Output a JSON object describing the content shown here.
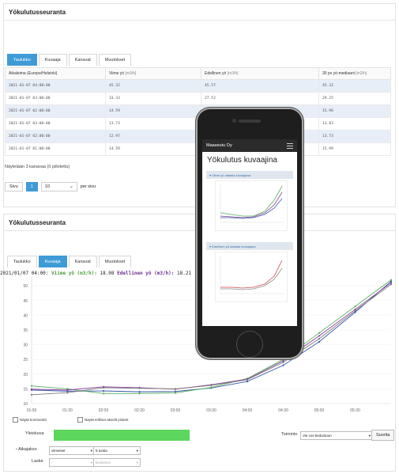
{
  "top_panel": {
    "title": "Yökulutusseuranta",
    "tabs": [
      "Taulukko",
      "Kuvaaja",
      "Kanavat",
      "Muutokset"
    ],
    "active_tab": 0,
    "table": {
      "headers": [
        {
          "label": "Aikaleima (Europe/Helsinki)",
          "unit": ""
        },
        {
          "label": "Viime yö",
          "unit": "[m3/h]"
        },
        {
          "label": "Edellinen yö",
          "unit": "[m3/h]"
        },
        {
          "label": "30 pv yö-mediaani",
          "unit": "[m3/h]"
        }
      ],
      "rows": [
        [
          "2021-01-07 04:00:00",
          "45.32",
          "45.57",
          "45.32"
        ],
        [
          "2021-01-07 03:00:00",
          "33.33",
          "27.52",
          "29.25"
        ],
        [
          "2021-01-07 02:00:00",
          "14.59",
          "",
          "15.96"
        ],
        [
          "2021-01-07 03:00:00",
          "13.73",
          "",
          "13.83"
        ],
        [
          "2021-01-07 02:00:00",
          "12.97",
          "",
          "13.73"
        ],
        [
          "2021-01-07 01:00:00",
          "14.59",
          "",
          "15.99"
        ]
      ]
    },
    "footer": "Näytetään 3 kanavaa (0 piilotettu)",
    "pager": {
      "prefix": "Sivu",
      "page": "1",
      "per_page": "10",
      "per_page_suffix": "per sivu"
    }
  },
  "bottom_panel": {
    "title": "Yökulutusseuranta",
    "tabs": [
      "Taulukko",
      "Kuvaaja",
      "Kanavat",
      "Muutokset"
    ],
    "active_tab": 1,
    "readout": {
      "timestamp": "2021/01/07 04:00:",
      "s1_label": "Viime yö (m3/h):",
      "s1_value": "18.08",
      "s2_label": "Edellinen yö (m3/h):",
      "s2_value": "18.21"
    },
    "checkboxes": [
      "Näytä kommentit",
      "Näytä erilliset akselit pisteet"
    ],
    "overview_label": "Yleiskuva",
    "toiminta_label": "Toiminto",
    "toiminta_value": "Vie csv-tiedostoon",
    "suorita_label": "Suorita",
    "aikajakso_label": "Aikajakso",
    "aikajakso_value": "viimeiset",
    "aikajakso_unit": "5 tuntia",
    "laske_label": "Laske",
    "laske_value": "-",
    "laske_unit": "keskiarvo",
    "colors": {
      "green": "#5cd65c",
      "accent": "#3f9bd6"
    }
  },
  "chart_data": {
    "type": "line",
    "x": [
      "01:00",
      "01:30",
      "02:00",
      "02:30",
      "03:00",
      "03:30",
      "04:00",
      "04:30",
      "05:00",
      "05:30"
    ],
    "yticks": [
      10,
      15,
      20,
      25,
      30,
      35,
      40,
      45,
      50
    ],
    "ylim": [
      10,
      53
    ],
    "series": [
      {
        "color": "#3a5aa8",
        "values": [
          14.6,
          14.2,
          14.3,
          14.0,
          14.1,
          15.3,
          17.5,
          23.0,
          31.0,
          41.0,
          51.5
        ]
      },
      {
        "color": "#55b05a",
        "values": [
          16.0,
          15.0,
          13.4,
          13.4,
          13.6,
          15.5,
          18.5,
          25.0,
          34.0,
          43.0,
          52.0
        ]
      },
      {
        "color": "#8a3fa0",
        "values": [
          14.9,
          14.6,
          15.7,
          15.4,
          14.9,
          16.4,
          18.3,
          24.5,
          33.0,
          42.0,
          51.0
        ]
      },
      {
        "color": "#7a7a7a",
        "values": [
          13.0,
          13.7,
          15.4,
          15.2,
          15.0,
          16.2,
          18.1,
          24.0,
          32.0,
          41.5,
          50.5
        ]
      }
    ]
  },
  "phone": {
    "company": "Maaseutu Oy",
    "title": "Yökulutus kuvaajina",
    "section1": "Viime yö datasta kuvaajana",
    "section2": "Edellinen yö datasta kuvaajana"
  }
}
